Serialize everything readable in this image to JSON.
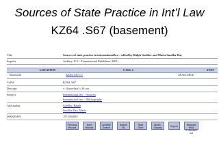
{
  "slide": {
    "title": "Sources of State Practice in Int’l Law",
    "subtitle": "KZ64 .S67 (basement)"
  },
  "record_top": [
    {
      "label": "Title",
      "value": "Sources of state practice in international law / edited by Ralph Gaebler and Maria Smolka-Day"
    },
    {
      "label": "Imprint",
      "value": "Ardsley, N.Y. : Transnational Publishers, 2001-"
    }
  ],
  "holdings": {
    "headers": {
      "location": "LOCATION",
      "call": "CALL #",
      "status": "STAT"
    },
    "location": "Basement",
    "call_number": "KZ64 .S67 v.1",
    "status": "AVAILABLE"
  },
  "record_bottom": [
    {
      "label": "Call #",
      "value": "KZ64 .S67",
      "link": false
    },
    {
      "label": "Descript",
      "value": "v. (loose-leaf) ; 26 cm",
      "link": false
    },
    {
      "label": "Subject",
      "value": "International law -- Sources",
      "link": true
    },
    {
      "label": "",
      "value": "International law -- Bibliography",
      "link": true
    },
    {
      "label": "Add author",
      "value": "Gaebler, Ralph",
      "link": true
    },
    {
      "label": "",
      "value": "Smolka-Day, Maria",
      "link": true
    },
    {
      "label": "ISBN/ISSN",
      "value": "1571052855",
      "link": false
    }
  ],
  "buttons": [
    {
      "line1": "Previous",
      "line2": "Record"
    },
    {
      "line1": "Next",
      "line2": "Record"
    },
    {
      "line1": "Another",
      "line2": "Search"
    },
    {
      "line1": "Search",
      "line2": "OIL"
    },
    {
      "line1": "Start",
      "line2": "Over"
    },
    {
      "line1": "MARC",
      "line2": "Display"
    },
    {
      "line1": "Export",
      "line2": ""
    },
    {
      "line1": "Request Hold",
      "line2": "if checked out"
    }
  ]
}
